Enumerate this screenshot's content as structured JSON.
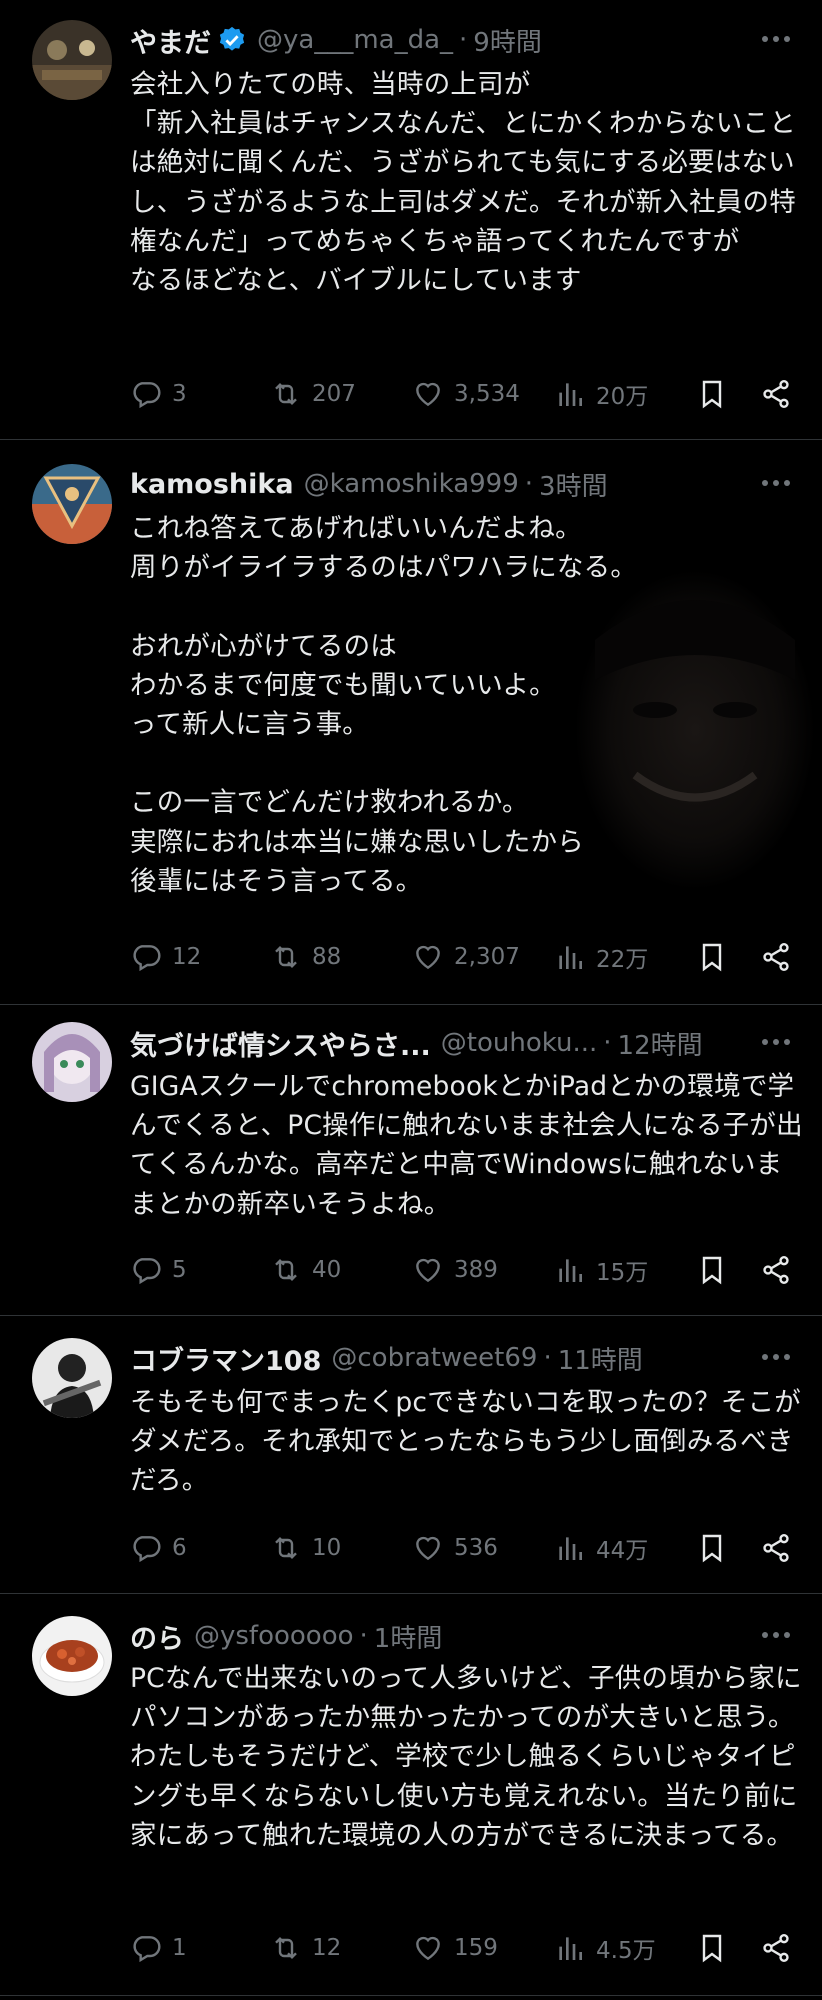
{
  "tweets": [
    {
      "name": "やまだ",
      "verified": true,
      "handle": "@ya___ma_da_",
      "separator": "·",
      "time": "9時間",
      "text": "会社入りたての時、当時の上司が\n「新入社員はチャンスなんだ、とにかくわからないことは絶対に聞くんだ、うざがられても気にする必要はないし、うざがるような上司はダメだ。それが新入社員の特権なんだ」ってめちゃくちゃ語ってくれたんですが\nなるほどなと、バイブルにしています",
      "replies": "3",
      "retweets": "207",
      "likes": "3,534",
      "views": "20万"
    },
    {
      "name": "kamoshika",
      "verified": false,
      "handle": "@kamoshika999",
      "separator": "·",
      "time": "3時間",
      "text": "これね答えてあげればいいんだよね。\n周りがイライラするのはパワハラになる。\n\nおれが心がけてるのは\nわかるまで何度でも聞いていいよ。\nって新人に言う事。\n\nこの一言でどんだけ救われるか。\n実際におれは本当に嫌な思いしたから\n後輩にはそう言ってる。",
      "replies": "12",
      "retweets": "88",
      "likes": "2,307",
      "views": "22万"
    },
    {
      "name": "気づけば情シスやらさ...",
      "verified": false,
      "handle": "@touhoku...",
      "separator": "·",
      "time": "12時間",
      "text": "GIGAスクールでchromebookとかiPadとかの環境で学んでくると、PC操作に触れないまま社会人になる子が出てくるんかな。高卒だと中高でWindowsに触れないままとかの新卒いそうよね。",
      "replies": "5",
      "retweets": "40",
      "likes": "389",
      "views": "15万"
    },
    {
      "name": "コブラマン108",
      "verified": false,
      "handle": "@cobratweet69",
      "separator": "·",
      "time": "11時間",
      "text": "そもそも何でまったくpcできないコを取ったの？そこがダメだろ。それ承知でとったならもう少し面倒みるべきだろ。",
      "replies": "6",
      "retweets": "10",
      "likes": "536",
      "views": "44万"
    },
    {
      "name": "のら",
      "verified": false,
      "handle": "@ysfoooooo",
      "separator": "·",
      "time": "1時間",
      "text": "PCなんで出来ないのって人多いけど、子供の頃から家にパソコンがあったか無かったかってのが大きいと思う。わたしもそうだけど、学校で少し触るくらいじゃタイピングも早くならないし使い方も覚えれない。当たり前に家にあって触れた環境の人の方ができるに決まってる。",
      "replies": "1",
      "retweets": "12",
      "likes": "159",
      "views": "4.5万"
    }
  ],
  "icons": {
    "reply": "reply-icon",
    "retweet": "retweet-icon",
    "like": "heart-icon",
    "views": "views-icon",
    "bookmark": "bookmark-icon",
    "share": "share-icon",
    "more": "more-icon"
  },
  "colors": {
    "background": "#000000",
    "text": "#e7e9ea",
    "muted": "#71767b",
    "verified": "#1d9bf0",
    "divider": "#2f3336"
  }
}
